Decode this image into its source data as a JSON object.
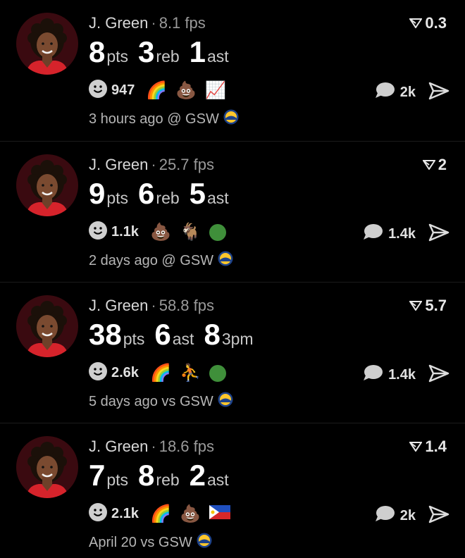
{
  "posts": [
    {
      "player": "J. Green",
      "fps": "8.1 fps",
      "score": "0.3",
      "stats": [
        {
          "value": "8",
          "unit": "pts"
        },
        {
          "value": "3",
          "unit": "reb"
        },
        {
          "value": "1",
          "unit": "ast"
        }
      ],
      "reaction_count": "947",
      "reaction_emojis": [
        "rainbow",
        "poop",
        "rising-chart"
      ],
      "comment_count": "2k",
      "time": "3 hours ago @ GSW"
    },
    {
      "player": "J. Green",
      "fps": "25.7 fps",
      "score": "2",
      "stats": [
        {
          "value": "9",
          "unit": "pts"
        },
        {
          "value": "6",
          "unit": "reb"
        },
        {
          "value": "5",
          "unit": "ast"
        }
      ],
      "reaction_count": "1.1k",
      "reaction_emojis": [
        "poop",
        "goat",
        "green-circle"
      ],
      "comment_count": "1.4k",
      "time": "2 days ago @ GSW"
    },
    {
      "player": "J. Green",
      "fps": "58.8 fps",
      "score": "5.7",
      "stats": [
        {
          "value": "38",
          "unit": "pts"
        },
        {
          "value": "6",
          "unit": "ast"
        },
        {
          "value": "8",
          "unit": "3pm"
        }
      ],
      "reaction_count": "2.6k",
      "reaction_emojis": [
        "rainbow",
        "dunk-figure",
        "green-circle"
      ],
      "comment_count": "1.4k",
      "time": "5 days ago vs GSW"
    },
    {
      "player": "J. Green",
      "fps": "18.6 fps",
      "score": "1.4",
      "stats": [
        {
          "value": "7",
          "unit": "pts"
        },
        {
          "value": "8",
          "unit": "reb"
        },
        {
          "value": "2",
          "unit": "ast"
        }
      ],
      "reaction_count": "2.1k",
      "reaction_emojis": [
        "rainbow",
        "poop",
        "philippines-flag"
      ],
      "comment_count": "2k",
      "time": "April 20 vs GSW"
    }
  ],
  "colors": {
    "background": "#000000",
    "avatar_bg": "#3a0a10",
    "jersey_red": "#d6232b",
    "gsw_blue": "#1d428a",
    "gsw_gold": "#ffc72c"
  }
}
